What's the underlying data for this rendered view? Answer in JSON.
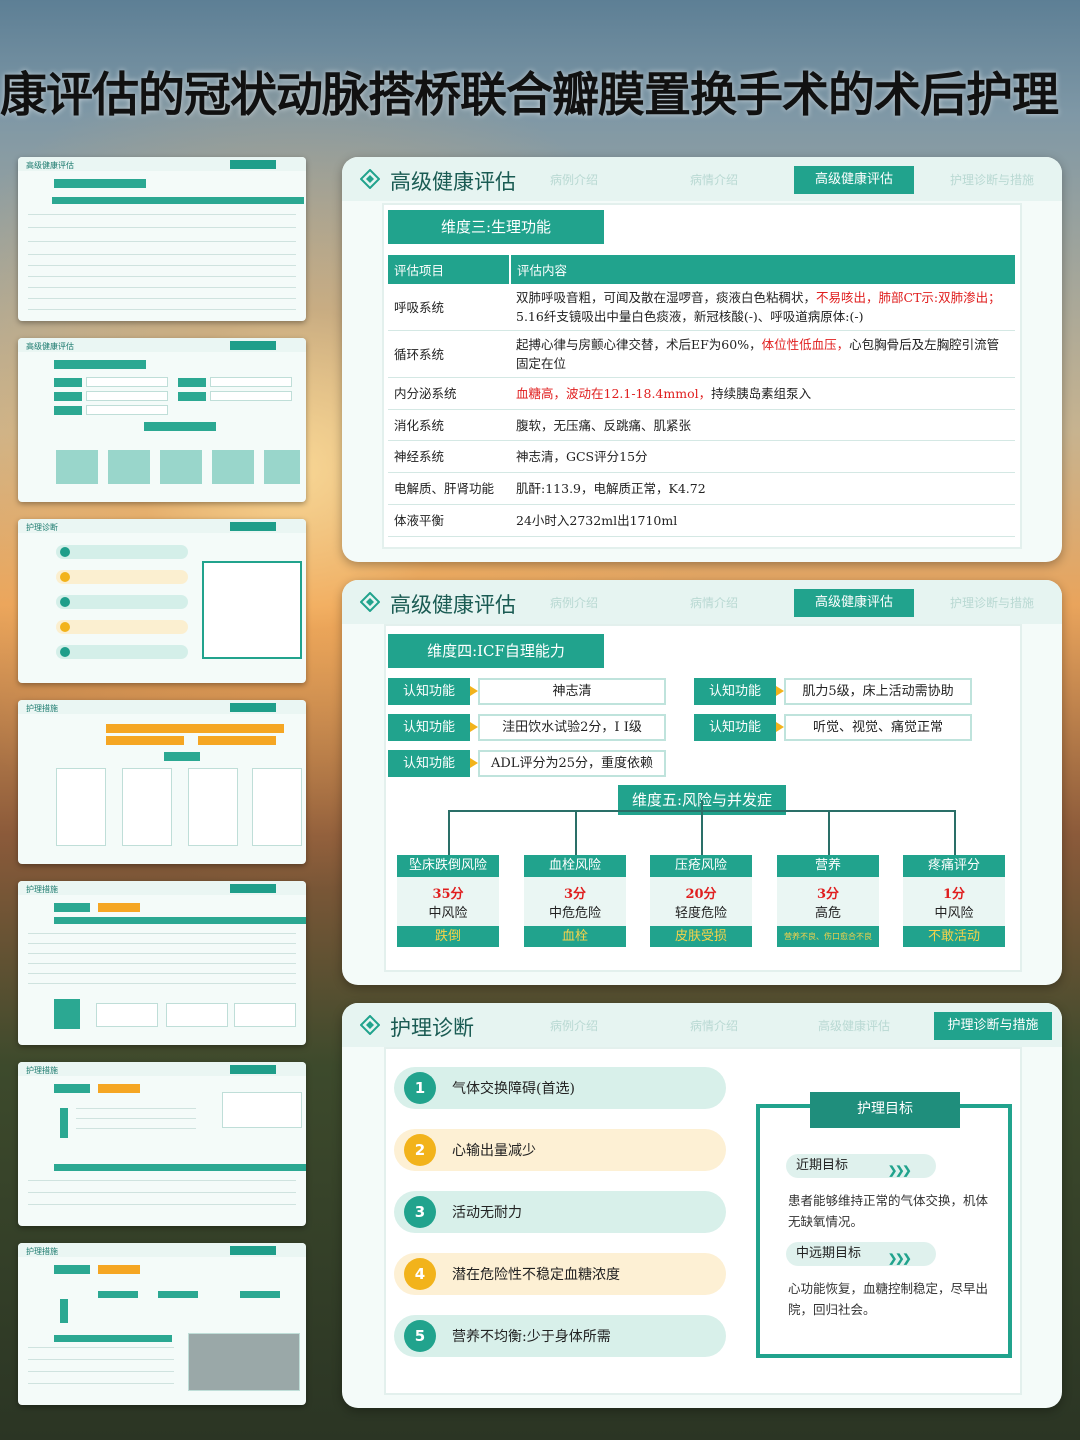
{
  "page_title": "康评估的冠状动脉搭桥联合瓣膜置换手术的术后护理",
  "nav": {
    "intro": "病例介绍",
    "case": "病情介绍",
    "advanced": "高级健康评估",
    "diagnosis": "护理诊断与措施"
  },
  "thumbnails": [
    {
      "title": "高级健康评估"
    },
    {
      "title": "高级健康评估"
    },
    {
      "title": "护理诊断"
    },
    {
      "title": "护理措施"
    },
    {
      "title": "护理措施"
    },
    {
      "title": "护理措施"
    },
    {
      "title": "护理措施"
    }
  ],
  "slide1": {
    "title": "高级健康评估",
    "section": "维度三:生理功能",
    "header": {
      "item": "评估项目",
      "content": "评估内容"
    },
    "rows": [
      {
        "item": "呼吸系统",
        "text": "双肺呼吸音粗，可闻及散在湿啰音，痰液白色粘稠状，",
        "red": "不易咳出，肺部CT示:双肺渗出；",
        "text2": "5.16纤支镜吸出中量白色痰液，新冠核酸(-)、呼吸道病原体:(-)"
      },
      {
        "item": "循环系统",
        "text": "起搏心律与房颤心律交替，术后EF为60%，",
        "red": "体位性低血压，",
        "text2": "心包胸骨后及左胸腔引流管固定在位"
      },
      {
        "item": "内分泌系统",
        "text": "",
        "red": "血糖高，波动在12.1-18.4mmol，",
        "text2": "持续胰岛素组泵入"
      },
      {
        "item": "消化系统",
        "text": "腹软，无压痛、反跳痛、肌紧张",
        "red": "",
        "text2": ""
      },
      {
        "item": "神经系统",
        "text": "神志清，GCS评分15分",
        "red": "",
        "text2": ""
      },
      {
        "item": "电解质、肝肾功能",
        "text": "肌酐:113.9，电解质正常，K4.72",
        "red": "",
        "text2": ""
      },
      {
        "item": "体液平衡",
        "text": "24小时入2732ml出1710ml",
        "red": "",
        "text2": ""
      }
    ]
  },
  "slide2": {
    "title": "高级健康评估",
    "section": "维度四:ICF自理能力",
    "cognitive": [
      {
        "label": "认知功能",
        "value": "神志清"
      },
      {
        "label": "认知功能",
        "value": "洼田饮水试验2分，I I级"
      },
      {
        "label": "认知功能",
        "value": "ADL评分为25分，重度依赖"
      },
      {
        "label": "认知功能",
        "value": "肌力5级，床上活动需协助"
      },
      {
        "label": "认知功能",
        "value": "听觉、视觉、痛觉正常"
      }
    ],
    "risk_section": "维度五:风险与并发症",
    "risks": [
      {
        "name": "坠床跌倒风险",
        "score": "35分",
        "level": "中风险",
        "foot": "跌倒"
      },
      {
        "name": "血栓风险",
        "score": "3分",
        "level": "中危危险",
        "foot": "血栓"
      },
      {
        "name": "压疮风险",
        "score": "20分",
        "level": "轻度危险",
        "foot": "皮肤受损"
      },
      {
        "name": "营养",
        "score": "3分",
        "level": "高危",
        "foot": "营养不良、伤口愈合不良"
      },
      {
        "name": "疼痛评分",
        "score": "1分",
        "level": "中风险",
        "foot": "不敢活动"
      }
    ]
  },
  "slide3": {
    "title": "护理诊断",
    "diagnoses": [
      {
        "num": "1",
        "text": "气体交换障碍(首选)"
      },
      {
        "num": "2",
        "text": "心输出量减少"
      },
      {
        "num": "3",
        "text": "活动无耐力"
      },
      {
        "num": "4",
        "text": "潜在危险性不稳定血糖浓度"
      },
      {
        "num": "5",
        "text": "营养不均衡:少于身体所需"
      }
    ],
    "goal": {
      "title": "护理目标",
      "short_label": "近期目标",
      "short_text": "患者能够维持正常的气体交换，机体无缺氧情况。",
      "long_label": "中远期目标",
      "long_text": "心功能恢复，血糖控制稳定，尽早出院，回归社会。"
    }
  },
  "colors": {
    "accent": "#21a38d",
    "warning": "#f2b31b",
    "alert": "#e01e1e"
  }
}
